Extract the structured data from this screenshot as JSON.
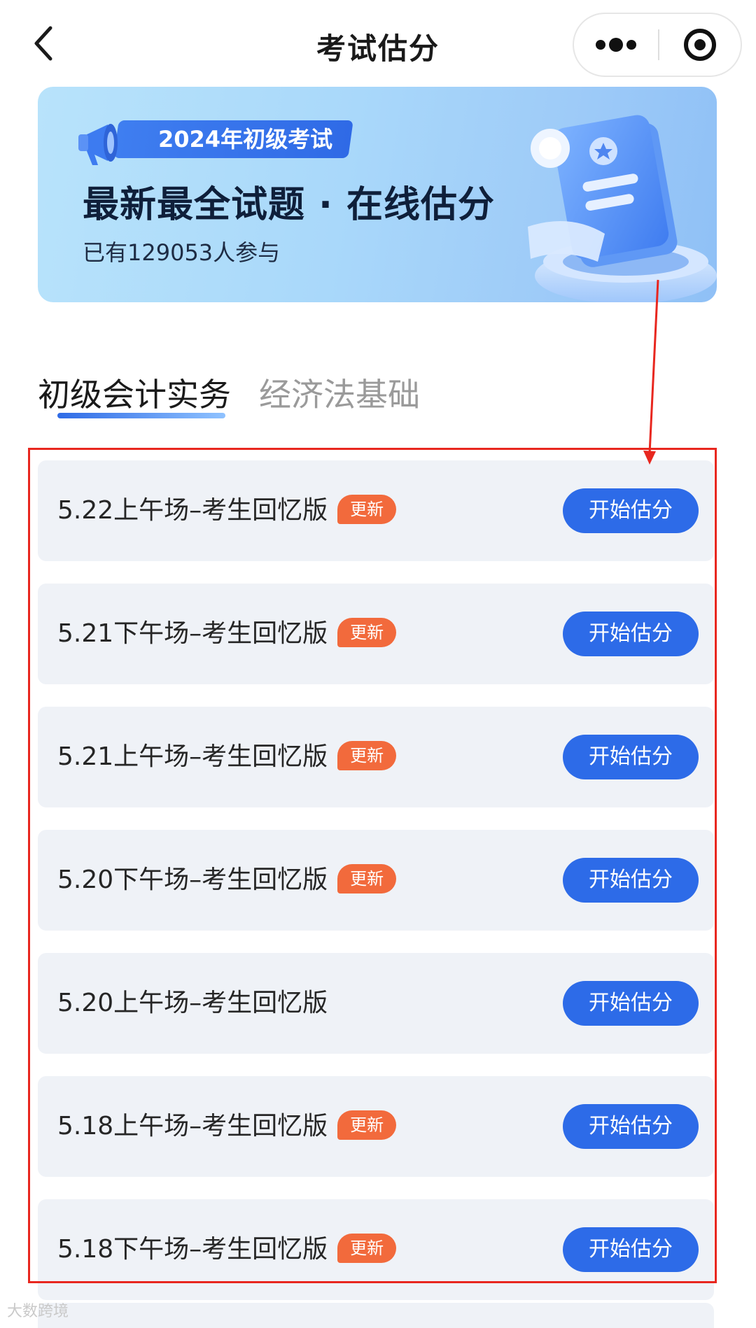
{
  "navbar": {
    "title": "考试估分",
    "back_icon": "chevron-left-icon",
    "more_icon": "more-dots-icon",
    "close_icon": "target-circle-icon"
  },
  "banner": {
    "tag": "2024年初级考试",
    "headline": "最新最全试题 · 在线估分",
    "participants": "已有129053人参与"
  },
  "tabs": [
    {
      "label": "初级会计实务",
      "active": true
    },
    {
      "label": "经济法基础",
      "active": false
    }
  ],
  "exams": [
    {
      "name": "5.22上午场–考生回忆版",
      "badge": "更新",
      "button": "开始估分"
    },
    {
      "name": "5.21下午场–考生回忆版",
      "badge": "更新",
      "button": "开始估分"
    },
    {
      "name": "5.21上午场–考生回忆版",
      "badge": "更新",
      "button": "开始估分"
    },
    {
      "name": "5.20下午场–考生回忆版",
      "badge": "更新",
      "button": "开始估分"
    },
    {
      "name": "5.20上午场–考生回忆版",
      "badge": "",
      "button": "开始估分"
    },
    {
      "name": "5.18上午场–考生回忆版",
      "badge": "更新",
      "button": "开始估分"
    },
    {
      "name": "5.18下午场–考生回忆版",
      "badge": "更新",
      "button": "开始估分"
    }
  ],
  "watermark": "大数跨境",
  "colors": {
    "accent": "#2d6be8",
    "badge": "#f26a3c",
    "annotation": "#e8271f",
    "row_background": "#eff2f7"
  }
}
